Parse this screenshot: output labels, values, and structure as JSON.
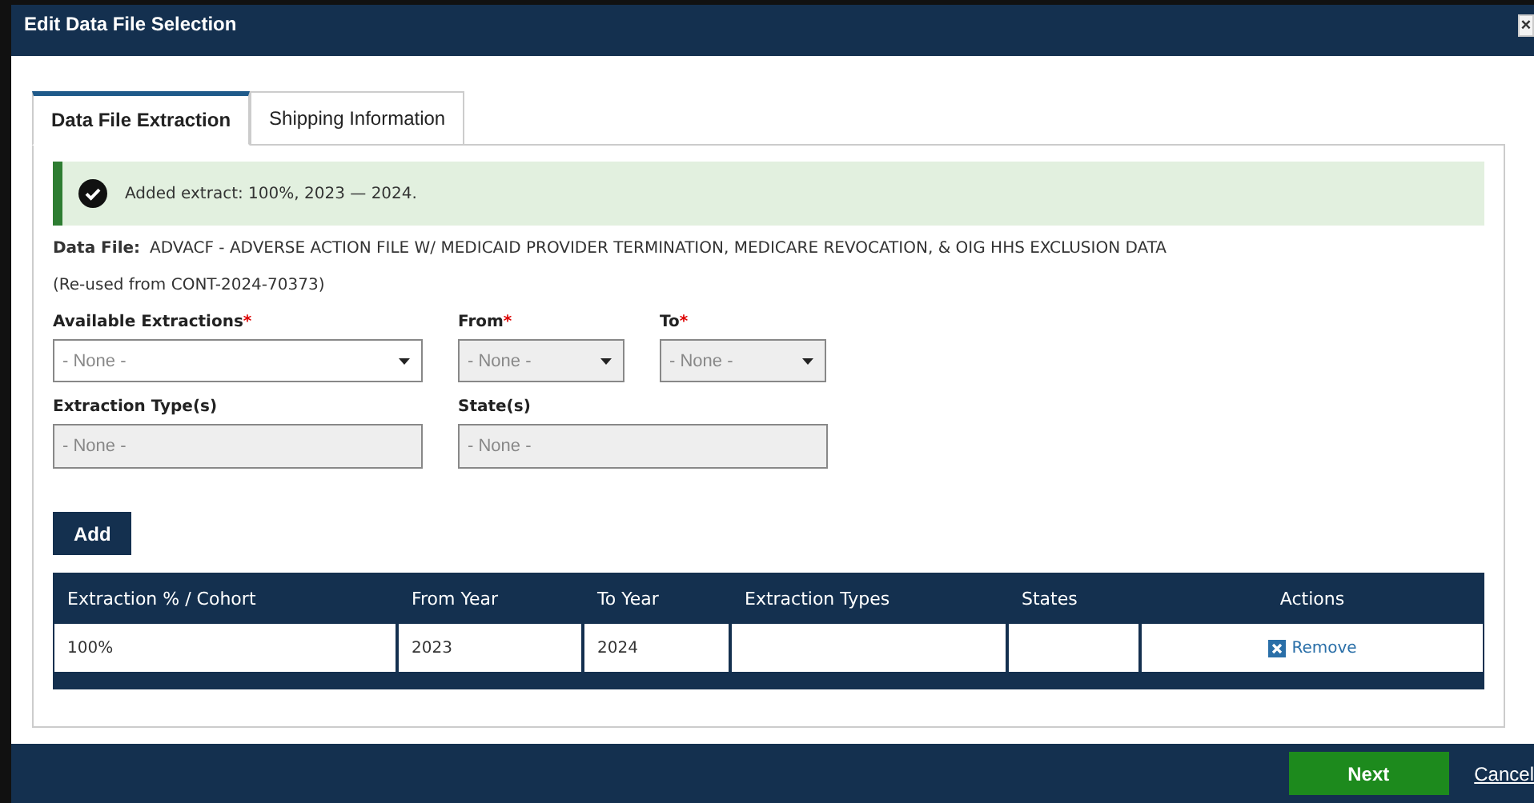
{
  "window": {
    "title": "Edit Data File Selection",
    "close": "×"
  },
  "tabs": [
    {
      "label": "Data File Extraction",
      "selected": true
    },
    {
      "label": "Shipping Information",
      "selected": false
    }
  ],
  "alert": {
    "message": "Added extract: 100%, 2023 — 2024."
  },
  "data_file": {
    "label": "Data File:",
    "value": "ADVACF - ADVERSE ACTION FILE W/ MEDICAID PROVIDER TERMINATION, MEDICARE REVOCATION, & OIG HHS EXCLUSION DATA"
  },
  "reused_note": "(Re-used from CONT-2024-70373)",
  "selectors": [
    {
      "label": "Available Extractions",
      "required": "*",
      "kind": "select",
      "placeholder": "- None -",
      "disabled": false
    },
    {
      "label": "From",
      "required": "*",
      "kind": "select",
      "placeholder": "- None -",
      "disabled": true
    },
    {
      "label": "To",
      "required": "*",
      "kind": "select",
      "placeholder": "- None -",
      "disabled": true
    }
  ],
  "details": [
    {
      "label": "Extraction Type(s)",
      "kind": "text",
      "placeholder": "- None -",
      "disabled": true
    },
    {
      "label": "State(s)",
      "kind": "text",
      "placeholder": "- None -",
      "disabled": true
    }
  ],
  "add_button": "Add",
  "table": {
    "columns": [
      "Extraction % / Cohort",
      "From Year",
      "To Year",
      "Extraction Types",
      "States",
      "Actions"
    ],
    "rows": [
      {
        "cells": [
          "100%",
          "2023",
          "2024",
          "",
          ""
        ],
        "action": "Remove"
      }
    ]
  },
  "footer": {
    "next": "Next",
    "cancel": "Cancel"
  }
}
